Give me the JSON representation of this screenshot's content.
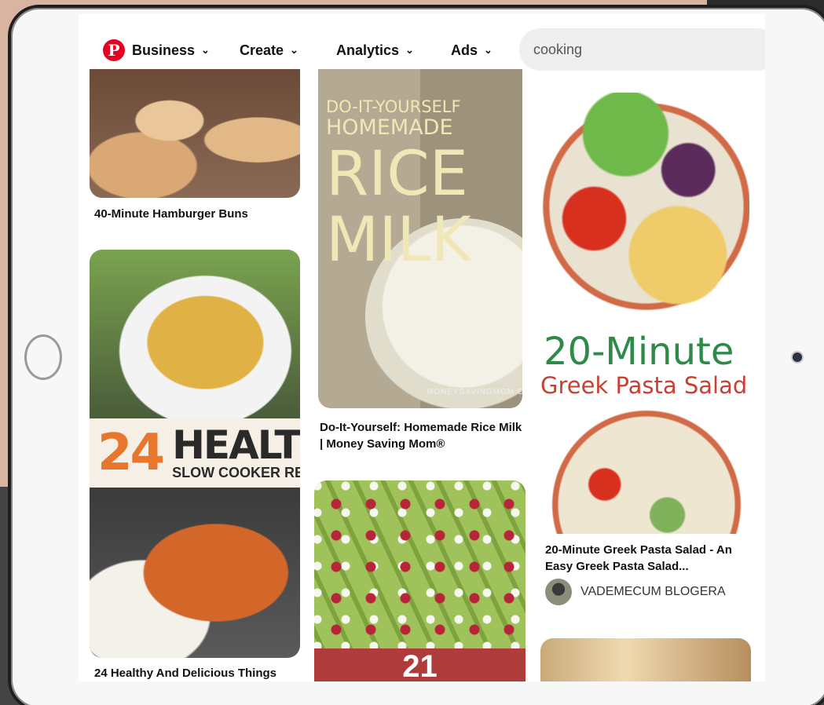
{
  "nav": {
    "logo": "P",
    "items": [
      {
        "label": "Business",
        "chevron": "⌄"
      },
      {
        "label": "Create",
        "chevron": "⌄"
      },
      {
        "label": "Analytics",
        "chevron": "⌄"
      },
      {
        "label": "Ads",
        "chevron": "⌄"
      }
    ],
    "search_value": "cooking"
  },
  "pins": {
    "buns": {
      "title": "40-Minute Hamburger Buns"
    },
    "healthy": {
      "title": "24 Healthy And Delicious Things",
      "banner_number": "24",
      "banner_word": "HEALTHY",
      "banner_sub": "SLOW COOKER RECIPES"
    },
    "rice": {
      "title": "Do-It-Yourself: Homemade Rice Milk | Money Saving Mom®",
      "line1": "DO-IT-YOURSELF",
      "line2": "HOMEMADE",
      "line3": "RICE",
      "line4": "MILK",
      "credit": "MONEYSAVINGMOM.COM"
    },
    "avocado": {
      "band_number": "21"
    },
    "pasta": {
      "title": "20-Minute Greek Pasta Salad - An Easy Greek Pasta Salad...",
      "overlay1": "20-Minute",
      "overlay2": "Greek Pasta Salad",
      "author": "VADEMECUM BLOGERA"
    }
  },
  "colors": {
    "brand": "#e60023"
  }
}
